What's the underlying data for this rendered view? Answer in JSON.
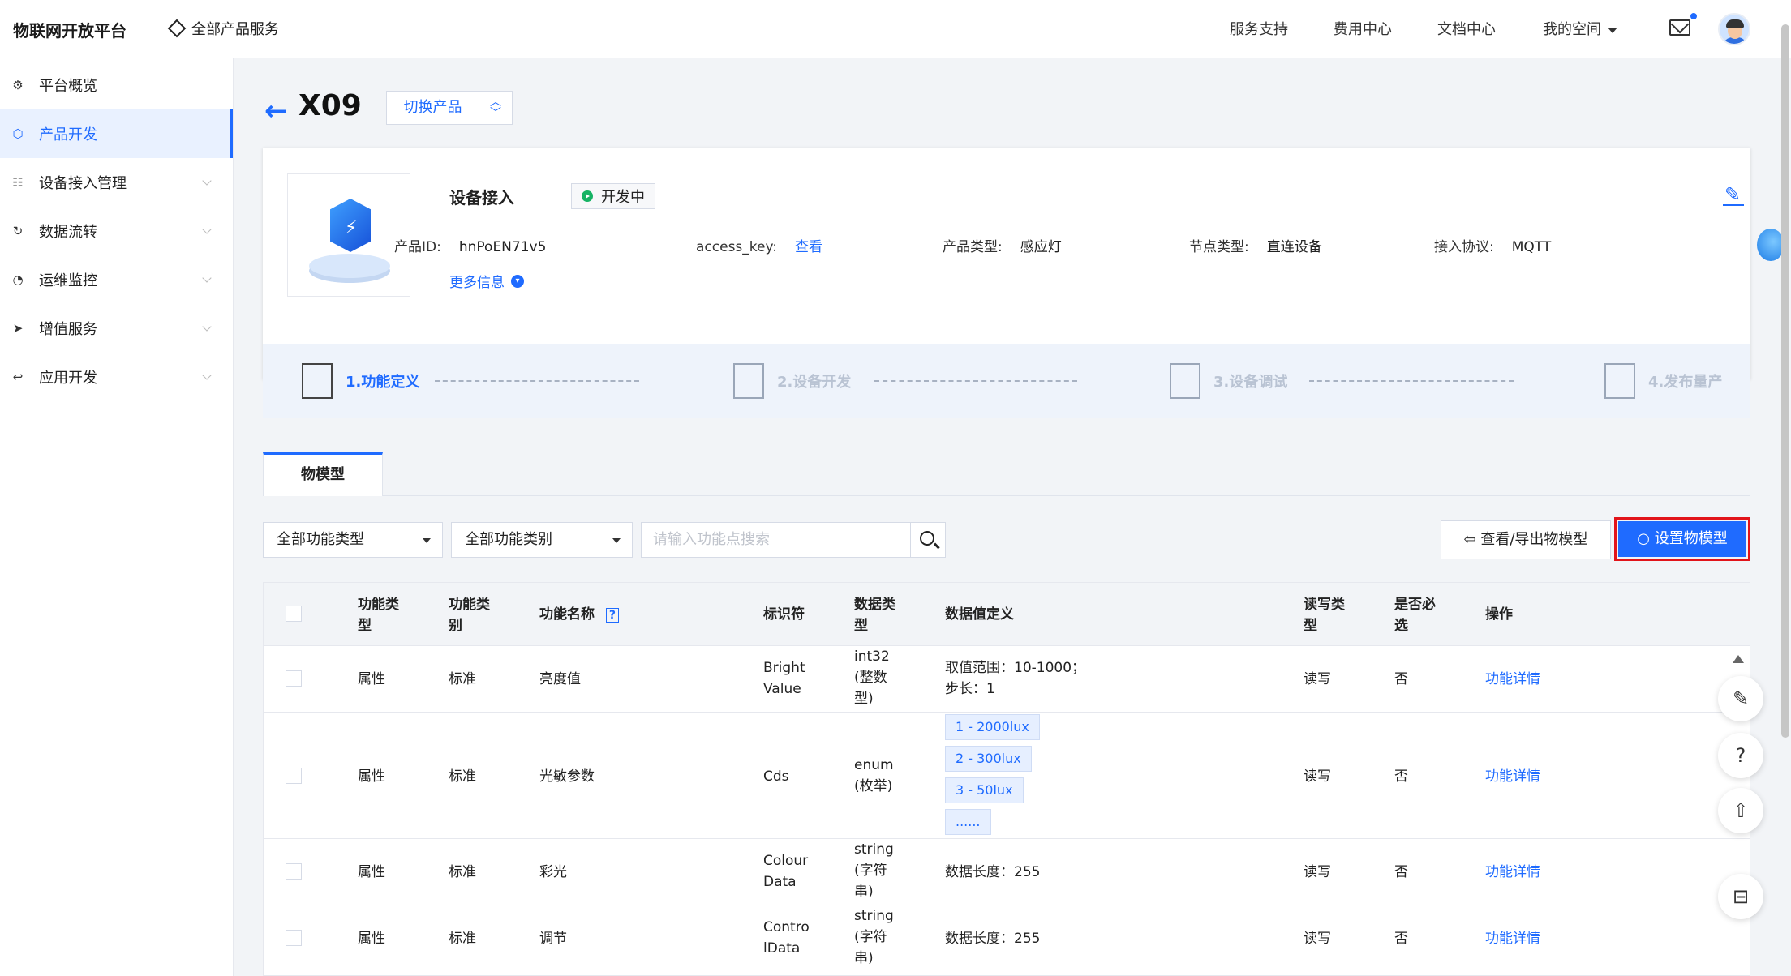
{
  "header": {
    "brand": "物联网开放平台",
    "all_products": "全部产品服务",
    "nav": [
      "服务支持",
      "费用中心",
      "文档中心",
      "我的空间"
    ]
  },
  "sidebar": {
    "items": [
      {
        "label": "平台概览",
        "icon": "overview-icon"
      },
      {
        "label": "产品开发",
        "icon": "cube-icon",
        "active": true
      },
      {
        "label": "设备接入管理",
        "icon": "device-access-icon"
      },
      {
        "label": "数据流转",
        "icon": "data-flow-icon"
      },
      {
        "label": "运维监控",
        "icon": "monitor-icon"
      },
      {
        "label": "增值服务",
        "icon": "send-icon"
      },
      {
        "label": "应用开发",
        "icon": "app-dev-icon"
      }
    ]
  },
  "product": {
    "title": "X09",
    "switch_label": "切换产品",
    "name": "设备接入",
    "status": "开发中",
    "fields": {
      "id_label": "产品ID:",
      "id_value": "hnPoEN71v5",
      "key_label": "access_key:",
      "key_link": "查看",
      "type_label": "产品类型:",
      "type_value": "感应灯",
      "node_label": "节点类型:",
      "node_value": "直连设备",
      "proto_label": "接入协议:",
      "proto_value": "MQTT"
    },
    "more_info": "更多信息"
  },
  "steps": [
    "1.功能定义",
    "2.设备开发",
    "3.设备调试",
    "4.发布量产"
  ],
  "tab": "物模型",
  "filters": {
    "type": "全部功能类型",
    "category": "全部功能类别",
    "search_placeholder": "请输入功能点搜索"
  },
  "buttons": {
    "export": "查看/导出物模型",
    "set_model": "设置物模型"
  },
  "table": {
    "headers": [
      "功能类型",
      "功能类别",
      "功能名称",
      "标识符",
      "数据类型",
      "数据值定义",
      "读写类型",
      "是否必选",
      "操作"
    ],
    "rows": [
      {
        "ftype": "属性",
        "fcat": "标准",
        "fname": "亮度值",
        "ident": "Bright Value",
        "dtype": "int32 (整数型)",
        "def": "取值范围：10-1000；",
        "def2": "步长：1",
        "rw": "读写",
        "req": "否",
        "op": "功能详情"
      },
      {
        "ftype": "属性",
        "fcat": "标准",
        "fname": "光敏参数",
        "ident": "Cds",
        "dtype": "enum (枚举)",
        "tags": [
          "1 - 2000lux",
          "2 - 300lux",
          "3 - 50lux",
          "......"
        ],
        "rw": "读写",
        "req": "否",
        "op": "功能详情"
      },
      {
        "ftype": "属性",
        "fcat": "标准",
        "fname": "彩光",
        "ident": "Colour Data",
        "dtype": "string (字符串)",
        "def": "数据长度：255",
        "rw": "读写",
        "req": "否",
        "op": "功能详情"
      },
      {
        "ftype": "属性",
        "fcat": "标准",
        "fname": "调节",
        "ident": "Contro lData",
        "dtype": "string (字符串)",
        "def": "数据长度：255",
        "rw": "读写",
        "req": "否",
        "op": "功能详情"
      }
    ]
  }
}
